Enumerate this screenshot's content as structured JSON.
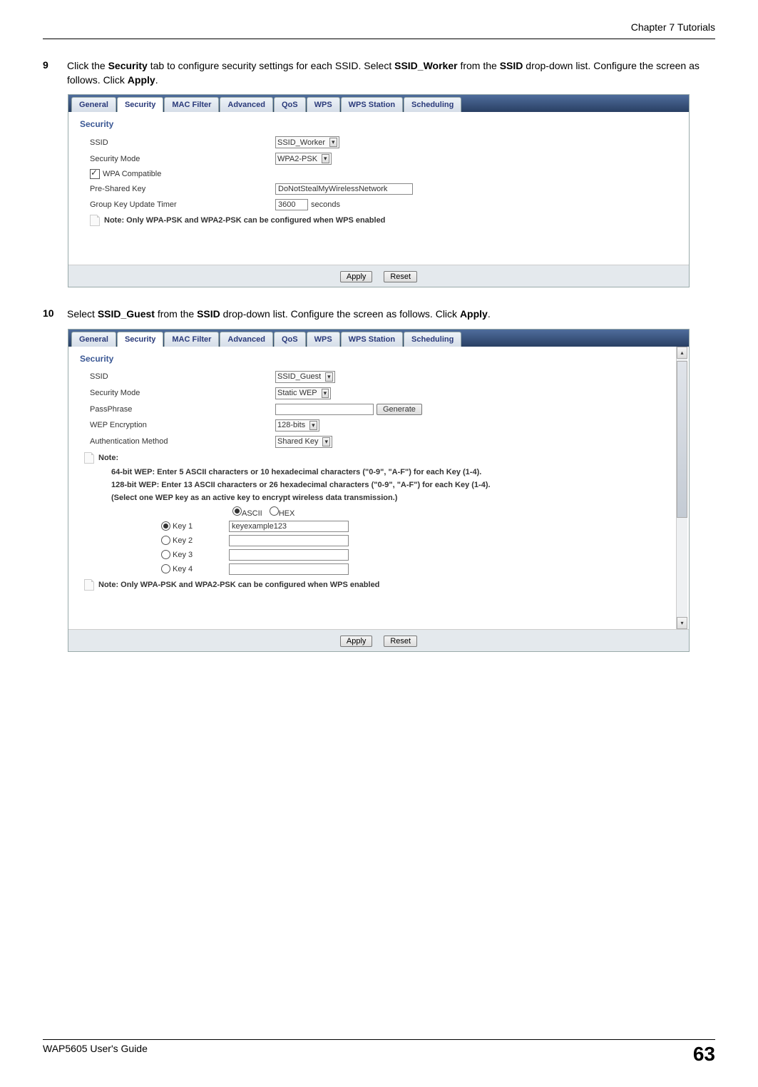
{
  "header": {
    "chapter": "Chapter 7 Tutorials"
  },
  "footer": {
    "guide": "WAP5605 User's Guide",
    "page": "63"
  },
  "step9": {
    "num": "9",
    "part1": "Click the ",
    "b1": "Security",
    "part2": " tab to configure security settings for each SSID. Select ",
    "b2": "SSID_Worker",
    "part3": " from the ",
    "b3": "SSID",
    "part4": " drop-down list. Configure the screen as follows. Click ",
    "b4": "Apply",
    "part5": "."
  },
  "step10": {
    "num": "10",
    "part1": "Select ",
    "b1": "SSID_Guest",
    "part2": " from the ",
    "b2": "SSID",
    "part3": " drop-down list. Configure the screen as follows. Click ",
    "b3": "Apply",
    "part4": "."
  },
  "tabs": {
    "general": "General",
    "security": "Security",
    "macfilter": "MAC Filter",
    "advanced": "Advanced",
    "qos": "QoS",
    "wps": "WPS",
    "wpsstation": "WPS Station",
    "scheduling": "Scheduling"
  },
  "panel1": {
    "section": "Security",
    "ssid_label": "SSID",
    "ssid_value": "SSID_Worker",
    "mode_label": "Security Mode",
    "mode_value": "WPA2-PSK",
    "wpa_compat": "WPA Compatible",
    "psk_label": "Pre-Shared Key",
    "psk_value": "DoNotStealMyWirelessNetwork",
    "timer_label": "Group Key Update Timer",
    "timer_value": "3600",
    "timer_unit": "seconds",
    "note": "Note: Only WPA-PSK and WPA2-PSK can be configured when WPS enabled",
    "apply": "Apply",
    "reset": "Reset"
  },
  "panel2": {
    "section": "Security",
    "ssid_label": "SSID",
    "ssid_value": "SSID_Guest",
    "mode_label": "Security Mode",
    "mode_value": "Static WEP",
    "passphrase_label": "PassPhrase",
    "generate": "Generate",
    "wep_label": "WEP Encryption",
    "wep_value": "128-bits",
    "auth_label": "Authentication Method",
    "auth_value": "Shared Key",
    "note_label": "Note:",
    "note_line1": "64-bit WEP: Enter 5 ASCII characters or 10 hexadecimal characters (\"0-9\", \"A-F\") for each Key (1-4).",
    "note_line2": "128-bit WEP: Enter 13 ASCII characters or 26 hexadecimal characters (\"0-9\", \"A-F\") for each Key (1-4).",
    "note_line3": "(Select one WEP key as an active key to encrypt wireless data transmission.)",
    "fmt_ascii": "ASCII",
    "fmt_hex": "HEX",
    "key1": "Key 1",
    "key2": "Key 2",
    "key3": "Key 3",
    "key4": "Key 4",
    "key1_val": "keyexample123",
    "note2": "Note: Only WPA-PSK and WPA2-PSK can be configured when WPS enabled",
    "apply": "Apply",
    "reset": "Reset"
  }
}
